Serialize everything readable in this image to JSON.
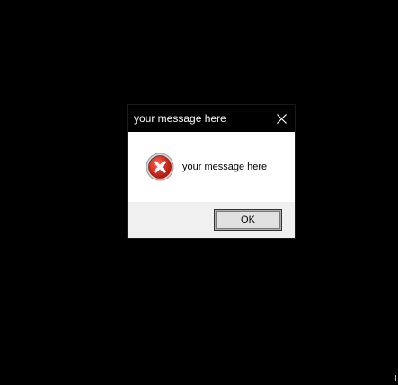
{
  "dialog": {
    "title": "your message here",
    "message": "your message here",
    "icon": "error-icon",
    "ok_label": "OK",
    "close_icon": "close-icon"
  },
  "colors": {
    "desktop_background": "#000000",
    "titlebar_background": "#000000",
    "titlebar_text": "#ffffff",
    "content_background": "#ffffff",
    "footer_background": "#f0f0f0",
    "button_background": "#e1e1e1",
    "error_red": "#c42b1c"
  }
}
